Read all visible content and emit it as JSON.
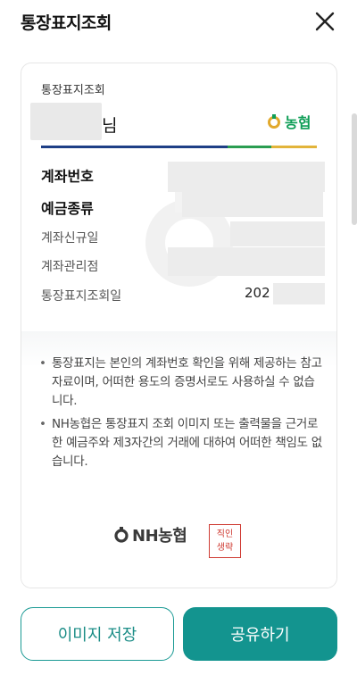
{
  "header": {
    "title": "통장표지조회"
  },
  "card": {
    "label": "통장표지조회",
    "name_suffix": "님",
    "bank_logo_text": "농협",
    "rows": [
      {
        "label": "계좌번호"
      },
      {
        "label": "예금종류"
      },
      {
        "label": "계좌신규일"
      },
      {
        "label": "계좌관리점"
      },
      {
        "label": "통장표지조회일",
        "value": "202"
      }
    ],
    "notices": [
      "통장표지는 본인의 계좌번호 확인을 위해 제공하는 참고자료이며, 어떠한 용도의 증명서로도 사용하실 수 없습니다.",
      "NH농협은 통장표지 조회 이미지 또는 출력물을 근거로 한 예금주와 제3자간의 거래에 대하여 어떠한 책임도 없습니다."
    ],
    "footer_logo_text": "NH농협",
    "stamp": {
      "line1": "직인",
      "line2": "생략"
    }
  },
  "buttons": {
    "save": "이미지 저장",
    "share": "공유하기"
  },
  "colors": {
    "nh_green": "#0f9e57",
    "primary_teal": "#13948f",
    "stripe_navy": "#1e3f86",
    "stripe_green": "#2a9d51",
    "stripe_yellow": "#e2b43a",
    "stamp_red": "#cf3b33"
  }
}
